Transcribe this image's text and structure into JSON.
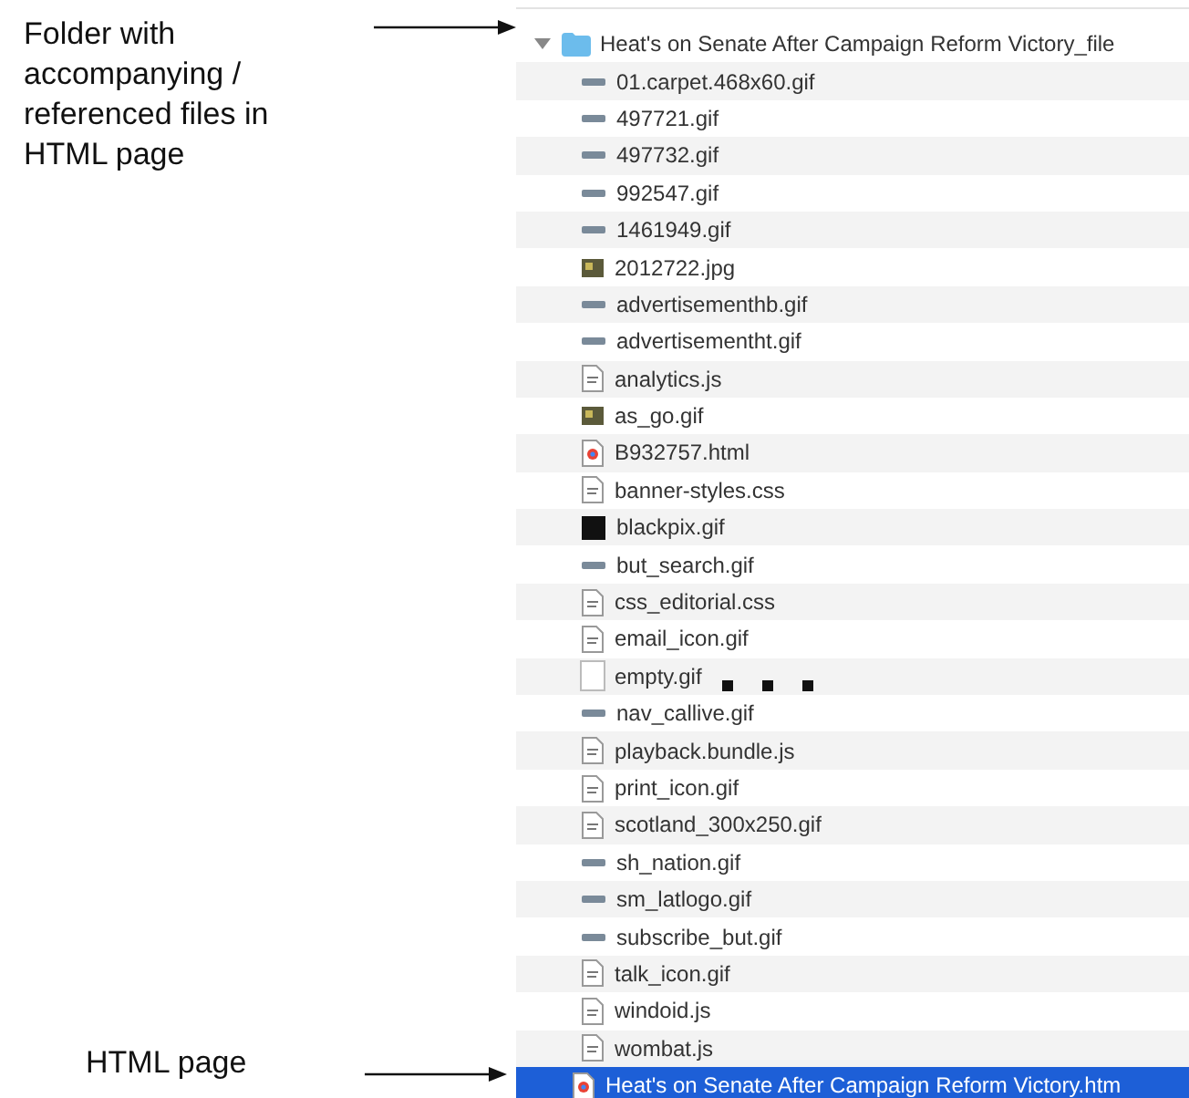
{
  "annotations": [
    {
      "text": "Folder with accompanying / referenced files in HTML page"
    },
    {
      "text": "HTML page"
    }
  ],
  "tree": [
    {
      "name": "Heat's on Senate After Campaign Reform Victory_file",
      "kind": "folder",
      "expanded": true,
      "selected": false,
      "children": [
        {
          "name": "01.carpet.468x60.gif",
          "kind": "strip",
          "selected": false
        },
        {
          "name": "497721.gif",
          "kind": "strip",
          "selected": false
        },
        {
          "name": "497732.gif",
          "kind": "strip",
          "selected": false
        },
        {
          "name": "992547.gif",
          "kind": "strip",
          "selected": false
        },
        {
          "name": "1461949.gif",
          "kind": "strip",
          "selected": false
        },
        {
          "name": "2012722.jpg",
          "kind": "photo",
          "selected": false
        },
        {
          "name": "advertisementhb.gif",
          "kind": "strip",
          "selected": false
        },
        {
          "name": "advertisementht.gif",
          "kind": "strip",
          "selected": false
        },
        {
          "name": "analytics.js",
          "kind": "doc",
          "selected": false
        },
        {
          "name": "as_go.gif",
          "kind": "photo",
          "selected": false
        },
        {
          "name": "B932757.html",
          "kind": "webpage",
          "selected": false
        },
        {
          "name": "banner-styles.css",
          "kind": "doc",
          "selected": false
        },
        {
          "name": "blackpix.gif",
          "kind": "square",
          "selected": false
        },
        {
          "name": "but_search.gif",
          "kind": "strip",
          "selected": false
        },
        {
          "name": "css_editorial.css",
          "kind": "doc",
          "selected": false
        },
        {
          "name": "email_icon.gif",
          "kind": "doc",
          "selected": false
        },
        {
          "name": "empty.gif",
          "kind": "blank",
          "selected": false
        },
        {
          "name": "nav_callive.gif",
          "kind": "strip",
          "selected": false
        },
        {
          "name": "playback.bundle.js",
          "kind": "doc",
          "selected": false
        },
        {
          "name": "print_icon.gif",
          "kind": "doc",
          "selected": false
        },
        {
          "name": "scotland_300x250.gif",
          "kind": "doc",
          "selected": false
        },
        {
          "name": "sh_nation.gif",
          "kind": "strip",
          "selected": false
        },
        {
          "name": "sm_latlogo.gif",
          "kind": "strip",
          "selected": false
        },
        {
          "name": "subscribe_but.gif",
          "kind": "strip",
          "selected": false
        },
        {
          "name": "talk_icon.gif",
          "kind": "doc",
          "selected": false
        },
        {
          "name": "windoid.js",
          "kind": "doc",
          "selected": false
        },
        {
          "name": "wombat.js",
          "kind": "doc",
          "selected": false
        }
      ]
    },
    {
      "name": "Heat's on Senate After Campaign Reform Victory.htm",
      "kind": "webpage",
      "selected": true
    }
  ]
}
